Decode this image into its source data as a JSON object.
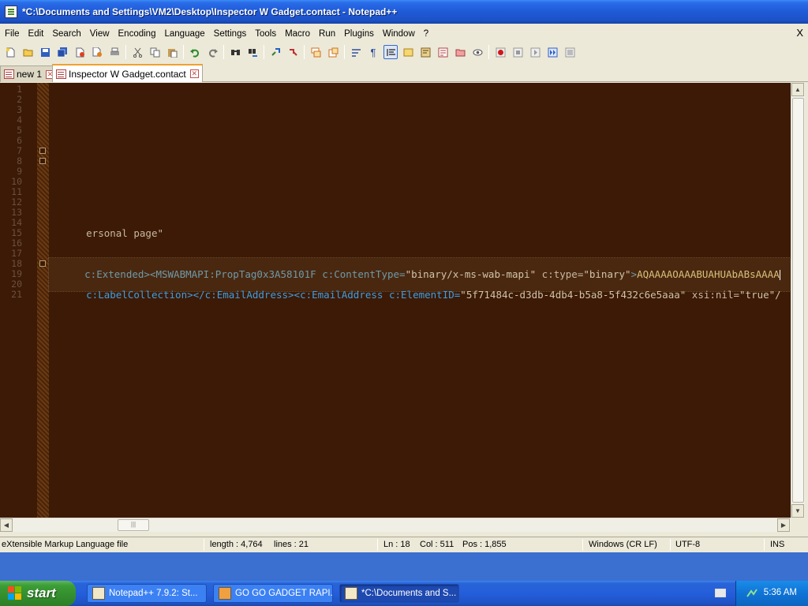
{
  "window": {
    "title": "*C:\\Documents and Settings\\VM2\\Desktop\\Inspector W Gadget.contact - Notepad++"
  },
  "menu": {
    "items": [
      "File",
      "Edit",
      "Search",
      "View",
      "Encoding",
      "Language",
      "Settings",
      "Tools",
      "Macro",
      "Run",
      "Plugins",
      "Window",
      "?"
    ],
    "close_label": "X"
  },
  "toolbar": {
    "buttons": [
      "new-file",
      "open-file",
      "save",
      "save-all",
      "close",
      "close-all",
      "print",
      "cut",
      "copy",
      "paste",
      "undo",
      "redo",
      "find",
      "replace",
      "zoom-in",
      "zoom-out",
      "sync-vertical",
      "sync-horizontal",
      "word-wrap",
      "show-all-chars",
      "indent-guide",
      "user-defined-language",
      "document-map",
      "function-list",
      "folder-as-workspace",
      "monitoring",
      "record-macro",
      "stop-recording",
      "playback-macro",
      "run-macro-multiple",
      "save-macro"
    ]
  },
  "tabs": [
    {
      "label": "new 1",
      "active": false
    },
    {
      "label": "Inspector W Gadget.contact",
      "active": true
    }
  ],
  "editor": {
    "line_numbers": [
      "1",
      "2",
      "3",
      "4",
      "5",
      "6",
      "7",
      "8",
      "9",
      "10",
      "11",
      "12",
      "13",
      "14",
      "15",
      "16",
      "17",
      "18",
      "19",
      "20",
      "21"
    ],
    "line14": "ersonal page\"",
    "line18": {
      "sel_tag": "c:Extended>",
      "sel_tag2": "<MSWABMAPI:PropTag0x3A58101F",
      "attr1": " c:ContentType=",
      "val1": "\"binary/x-ms-wab-mapi\"",
      "attr2": " c:type=",
      "val2": "\"binary\"",
      "close": ">",
      "binary": "AQAAAAOAAABUAHUAbABsAAAA"
    },
    "line20": {
      "tag1": "c:LabelCollection></c:EmailAddress><c:EmailAddress",
      "attr1": " c:ElementID=",
      "val1": "\"5f71484c-d3db-4db4-b5a8-5f432c6e5aaa\"",
      "attr2": " xsi:nil=",
      "val2": "\"true\"/"
    }
  },
  "statusbar": {
    "file_type": "eXtensible Markup Language file",
    "length": "length : 4,764",
    "lines": "lines : 21",
    "ln": "Ln : 18",
    "col": "Col : 511",
    "pos": "Pos : 1,855",
    "eol": "Windows (CR LF)",
    "encoding": "UTF-8",
    "mode": "INS"
  },
  "taskbar": {
    "start_label": "start",
    "tasks": [
      {
        "label": "Notepad++ 7.9.2: St...",
        "active": false
      },
      {
        "label": "GO GO GADGET RAPI...",
        "active": false
      },
      {
        "label": "*C:\\Documents and S...",
        "active": true
      }
    ],
    "clock": "5:36 AM"
  },
  "colors": {
    "editor_bg": "#3c1a06",
    "tag": "#3f9fe0",
    "title_bar": "#1f5ad6",
    "start_green": "#338e2d"
  }
}
